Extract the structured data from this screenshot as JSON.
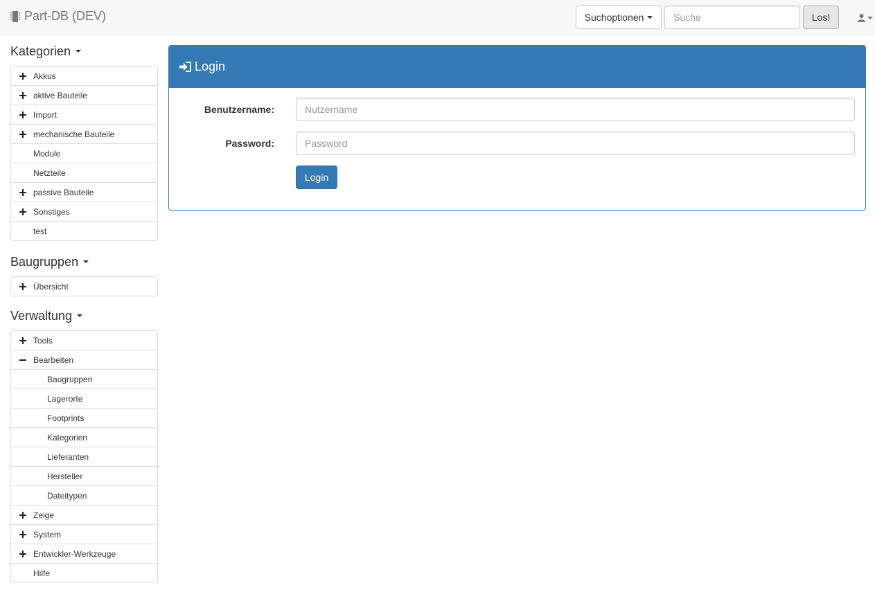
{
  "navbar": {
    "brand": "Part-DB (DEV)",
    "search_options_label": "Suchoptionen",
    "search_placeholder": "Suche",
    "search_value": "",
    "search_button": "Los!"
  },
  "sidebar": {
    "categories": {
      "title": "Kategorien",
      "items": [
        {
          "label": "Akkus",
          "expander": "plus"
        },
        {
          "label": "aktive Bauteile",
          "expander": "plus"
        },
        {
          "label": "Import",
          "expander": "plus"
        },
        {
          "label": "mechanische Bauteile",
          "expander": "plus"
        },
        {
          "label": "Module",
          "expander": "none"
        },
        {
          "label": "Netzteile",
          "expander": "none"
        },
        {
          "label": "passive Bauteile",
          "expander": "plus"
        },
        {
          "label": "Sonstiges",
          "expander": "plus"
        },
        {
          "label": "test",
          "expander": "none"
        }
      ]
    },
    "assemblies": {
      "title": "Baugruppen",
      "items": [
        {
          "label": "Übersicht",
          "expander": "plus"
        }
      ]
    },
    "administration": {
      "title": "Verwaltung",
      "items": [
        {
          "label": "Tools",
          "expander": "plus"
        },
        {
          "label": "Bearbeiten",
          "expander": "minus"
        },
        {
          "label": "Baugruppen",
          "expander": "child"
        },
        {
          "label": "Lagerorte",
          "expander": "child"
        },
        {
          "label": "Footprints",
          "expander": "child"
        },
        {
          "label": "Kategorien",
          "expander": "child"
        },
        {
          "label": "Lieferanten",
          "expander": "child"
        },
        {
          "label": "Hersteller",
          "expander": "child"
        },
        {
          "label": "Dateitypen",
          "expander": "child"
        },
        {
          "label": "Zeige",
          "expander": "plus"
        },
        {
          "label": "System",
          "expander": "plus"
        },
        {
          "label": "Entwickler-Werkzeuge",
          "expander": "plus"
        },
        {
          "label": "Hilfe",
          "expander": "none"
        }
      ]
    }
  },
  "login": {
    "title": "Login",
    "username_label": "Benutzername:",
    "username_placeholder": "Nutzername",
    "username_value": "",
    "password_label": "Password:",
    "password_placeholder": "Password",
    "password_value": "",
    "submit_label": "Login"
  },
  "colors": {
    "primary": "#337ab7",
    "navbar_bg": "#f8f8f8",
    "border": "#dddddd"
  }
}
